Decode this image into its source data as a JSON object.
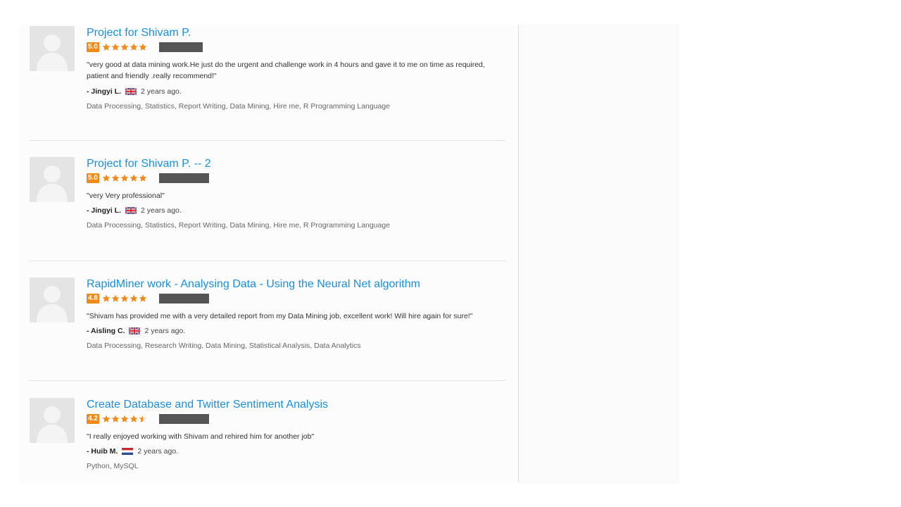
{
  "reviews": [
    {
      "title": "Project for Shivam P.",
      "rating": "5.0",
      "stars": 5,
      "quote": "\"very good at data mining work.He just do the urgent and challenge work in 4 hours and gave it to me on time as required, patient and friendly .really recommend!\"",
      "author": "- Jingyi L.",
      "flag": "uk",
      "time": "2 years ago.",
      "skills": "Data Processing, Statistics, Report Writing, Data Mining, Hire me, R Programming Language"
    },
    {
      "title": "Project for Shivam P. -- 2",
      "rating": "5.0",
      "stars": 5,
      "quote": "\"very Very professional\"",
      "author": "- Jingyi L.",
      "flag": "uk",
      "time": "2 years ago.",
      "skills": "Data Processing, Statistics, Report Writing, Data Mining, Hire me, R Programming Language"
    },
    {
      "title": "RapidMiner work - Analysing Data - Using the Neural Net algorithm",
      "rating": "4.8",
      "stars": 5,
      "quote": "\"Shivam has provided me with a very detailed report from my Data Mining job, excellent work! Will hire again for sure!\"",
      "author": "- Aisling C.",
      "flag": "uk",
      "time": "2 years ago.",
      "skills": "Data Processing, Research Writing, Data Mining, Statistical Analysis, Data Analytics"
    },
    {
      "title": "Create Database and Twitter Sentiment Analysis",
      "rating": "4.2",
      "stars": 4.5,
      "quote": "\"I really enjoyed working with Shivam and rehired him for another job\"",
      "author": "- Huib M.",
      "flag": "nl",
      "time": "2 years ago.",
      "skills": "Python, MySQL"
    }
  ],
  "colors": {
    "link": "#1a8fe0",
    "star": "#f28a1a",
    "badge": "#f28a1a",
    "redacted": "#555555"
  }
}
